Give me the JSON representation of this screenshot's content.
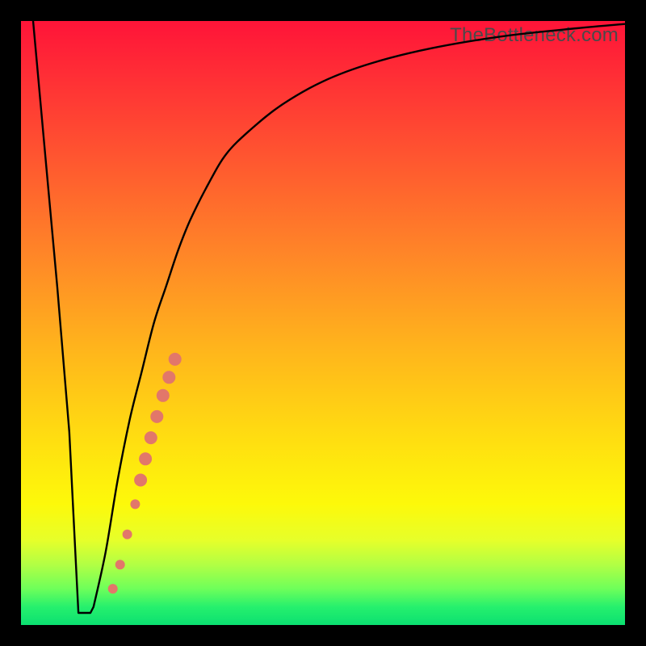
{
  "watermark": "TheBottleneck.com",
  "chart_data": {
    "type": "line",
    "title": "",
    "xlabel": "",
    "ylabel": "",
    "xlim": [
      0,
      100
    ],
    "ylim": [
      0,
      100
    ],
    "series": [
      {
        "name": "bottleneck-curve",
        "x": [
          2,
          4,
          6,
          8,
          9,
          10,
          11,
          12,
          14,
          16,
          18,
          20,
          22,
          24,
          26,
          28,
          31,
          34,
          38,
          43,
          50,
          58,
          68,
          80,
          92,
          100
        ],
        "y": [
          100,
          78,
          56,
          32,
          12,
          3,
          2,
          3,
          12,
          24,
          34,
          42,
          50,
          56,
          62,
          67,
          73,
          78,
          82,
          86,
          90,
          93,
          95.5,
          97.5,
          98.8,
          99.5
        ]
      }
    ],
    "flat_segment": {
      "x_start": 9.5,
      "x_end": 11.5,
      "y": 2
    },
    "markers": [
      {
        "x": 15.2,
        "y": 6.0,
        "r": 6
      },
      {
        "x": 16.4,
        "y": 10.0,
        "r": 6
      },
      {
        "x": 17.6,
        "y": 15.0,
        "r": 6
      },
      {
        "x": 18.9,
        "y": 20.0,
        "r": 6
      },
      {
        "x": 19.8,
        "y": 24.0,
        "r": 8
      },
      {
        "x": 20.6,
        "y": 27.5,
        "r": 8
      },
      {
        "x": 21.5,
        "y": 31.0,
        "r": 8
      },
      {
        "x": 22.5,
        "y": 34.5,
        "r": 8
      },
      {
        "x": 23.5,
        "y": 38.0,
        "r": 8
      },
      {
        "x": 24.5,
        "y": 41.0,
        "r": 8
      },
      {
        "x": 25.5,
        "y": 44.0,
        "r": 8
      }
    ],
    "marker_color": "#e2776a",
    "curve_color": "#000000"
  }
}
